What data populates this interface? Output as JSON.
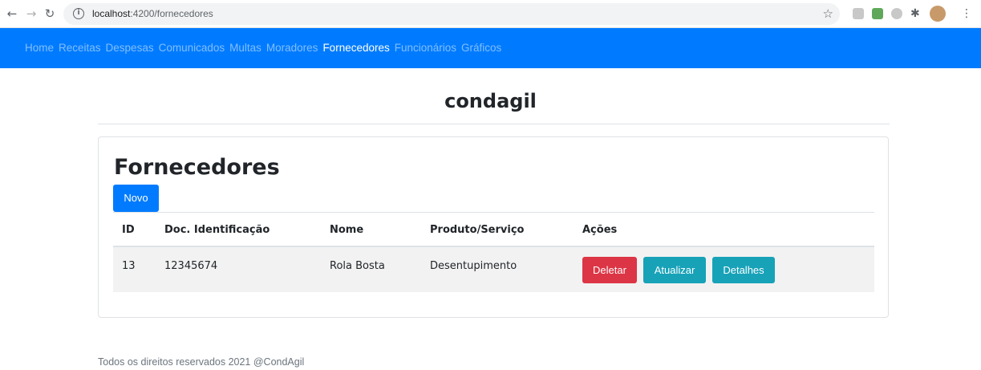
{
  "browser": {
    "url_host": "localhost",
    "url_path": ":4200/fornecedores",
    "icons": [
      "back-arrow-icon",
      "forward-arrow-icon",
      "reload-icon",
      "info-icon",
      "star-icon",
      "puzzle-icon",
      "kebab-menu-icon"
    ]
  },
  "navbar": {
    "items": [
      {
        "label": "Home"
      },
      {
        "label": "Receitas"
      },
      {
        "label": "Despesas"
      },
      {
        "label": "Comunicados"
      },
      {
        "label": "Multas"
      },
      {
        "label": "Moradores"
      },
      {
        "label": "Fornecedores",
        "active": true
      },
      {
        "label": "Funcionários"
      },
      {
        "label": "Gráficos"
      }
    ],
    "background": "#007bff"
  },
  "header": {
    "title": "condagil"
  },
  "card": {
    "title": "Fornecedores",
    "new_button": "Novo",
    "table": {
      "columns": [
        "ID",
        "Doc. Identificação",
        "Nome",
        "Produto/Serviço",
        "Ações"
      ],
      "rows": [
        {
          "id": "13",
          "doc": "12345674",
          "nome": "Rola Bosta",
          "produto": "Desentupimento",
          "actions": {
            "delete": "Deletar",
            "update": "Atualizar",
            "details": "Detalhes"
          }
        }
      ]
    }
  },
  "footer": {
    "text": "Todos os direitos reservados 2021 @CondAgil"
  },
  "colors": {
    "primary": "#007bff",
    "danger": "#dc3545",
    "info": "#17a2b8"
  }
}
